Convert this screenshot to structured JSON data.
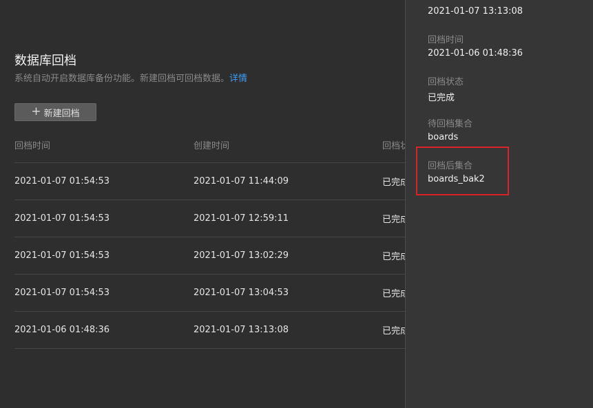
{
  "main": {
    "title": "数据库回档",
    "description": "系统自动开启数据库备份功能。新建回档可回档数据。",
    "details_link": "详情",
    "new_button_icon": "plus-icon",
    "new_button_label": "新建回档"
  },
  "table": {
    "headers": [
      "回档时间",
      "创建时间",
      "回档状态"
    ],
    "rows": [
      {
        "rollback_time": "2021-01-07 01:54:53",
        "created_time": "2021-01-07 11:44:09",
        "status": "已完成"
      },
      {
        "rollback_time": "2021-01-07 01:54:53",
        "created_time": "2021-01-07 12:59:11",
        "status": "已完成"
      },
      {
        "rollback_time": "2021-01-07 01:54:53",
        "created_time": "2021-01-07 13:02:29",
        "status": "已完成"
      },
      {
        "rollback_time": "2021-01-07 01:54:53",
        "created_time": "2021-01-07 13:04:53",
        "status": "已完成"
      },
      {
        "rollback_time": "2021-01-06 01:48:36",
        "created_time": "2021-01-07 13:13:08",
        "status": "已完成"
      }
    ]
  },
  "panel": {
    "created_time_value": "2021-01-07 13:13:08",
    "rollback_time_label": "回档时间",
    "rollback_time_value": "2021-01-06 01:48:36",
    "status_label": "回档状态",
    "status_value": "已完成",
    "source_collection_label": "待回档集合",
    "source_collection_value": "boards",
    "target_collection_label": "回档后集合",
    "target_collection_value": "boards_bak2"
  },
  "colors": {
    "background": "#2e2e2e",
    "panel": "#363636",
    "link": "#3d9cf5",
    "highlight": "#d9232a"
  }
}
